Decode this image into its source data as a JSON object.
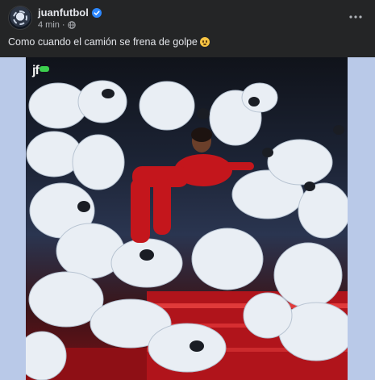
{
  "post": {
    "author": "juanfutbol",
    "verified": true,
    "time": "4 min",
    "audience_icon": "globe-icon",
    "more_icon": "more-options-icon",
    "caption": "Como cuando el camión se frena de golpe",
    "caption_emoji": "face-with-open-mouth-emoji",
    "media": {
      "watermark": "jf",
      "description_icon": "photo"
    }
  },
  "colors": {
    "background": "#242526",
    "text_primary": "#e4e6eb",
    "text_secondary": "#b0b3b8",
    "verified_blue": "#2d88ff",
    "media_frame": "#b9c9e8",
    "dress_red": "#c4161c"
  }
}
